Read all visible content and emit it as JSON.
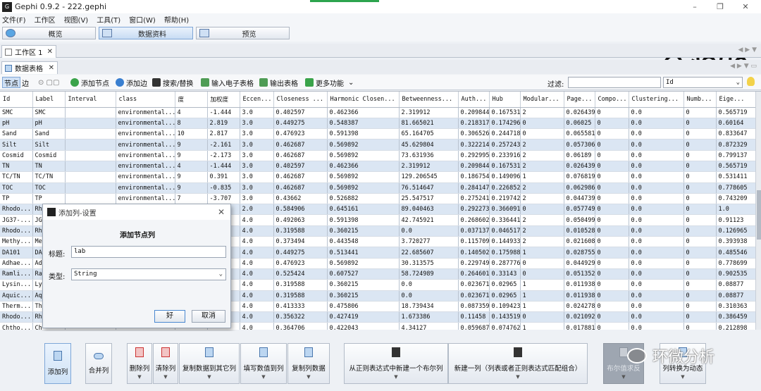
{
  "window": {
    "title": "Gephi 0.9.2 - 222.gephi",
    "app_icon": "gephi-logo-icon"
  },
  "menu": [
    "文件(F)",
    "工作区",
    "视图(V)",
    "工具(T)",
    "窗口(W)",
    "帮助(H)"
  ],
  "modes": [
    {
      "label": "概览"
    },
    {
      "label": "数据资料"
    },
    {
      "label": "预览"
    }
  ],
  "logo_text": "gephi",
  "workspace_tab": {
    "label": "工作区 1",
    "close": "✕"
  },
  "datatable_tab": {
    "label": "数据表格",
    "close": "✕"
  },
  "toolbar": {
    "nodes": "节点",
    "edges": "边",
    "add_node": "添加节点",
    "add_edge": "添加边",
    "search_replace": "搜索/替换",
    "import_sheet": "输入电子表格",
    "export_table": "输出表格",
    "more": "更多功能",
    "filter_label": "过滤:",
    "filter_value": "",
    "filter_column": "Id"
  },
  "table": {
    "columns": [
      "Id",
      "Label",
      "Interval",
      "class",
      "度",
      "加权度",
      "Eccen...",
      "Closeness ...",
      "Harmonic Closen...",
      "Betweenness...",
      "Auth...",
      "Hub",
      "Modular...",
      "Page...",
      "Compo...",
      "Clustering...",
      "Numb...",
      "Eige..."
    ],
    "rows": [
      [
        "SMC",
        "SMC",
        "",
        "environmental...",
        "4",
        "-1.444",
        "3.0",
        "0.402597",
        "0.462366",
        "2.319912",
        "0.209844",
        "0.167531",
        "2",
        "0.026439",
        "0",
        "0.0",
        "0",
        "0.565719"
      ],
      [
        "pH",
        "pH",
        "",
        "environmental...",
        "8",
        "2.819",
        "3.0",
        "0.449275",
        "0.548387",
        "81.665021",
        "0.218317",
        "0.174296",
        "0",
        "0.06025",
        "0",
        "0.0",
        "0",
        "0.60164"
      ],
      [
        "Sand",
        "Sand",
        "",
        "environmental...",
        "10",
        "2.817",
        "3.0",
        "0.476923",
        "0.591398",
        "65.164705",
        "0.306526",
        "0.244718",
        "0",
        "0.065581",
        "0",
        "0.0",
        "0",
        "0.833647"
      ],
      [
        "Silt",
        "Silt",
        "",
        "environmental...",
        "9",
        "-2.161",
        "3.0",
        "0.462687",
        "0.569892",
        "45.629804",
        "0.322214",
        "0.257243",
        "2",
        "0.057306",
        "0",
        "0.0",
        "0",
        "0.872329"
      ],
      [
        "Cosmid",
        "Cosmid",
        "",
        "environmental...",
        "9",
        "-2.173",
        "3.0",
        "0.462687",
        "0.569892",
        "73.631936",
        "0.292995",
        "0.233916",
        "2",
        "0.06189",
        "0",
        "0.0",
        "0",
        "0.799137"
      ],
      [
        "TN",
        "TN",
        "",
        "environmental...",
        "4",
        "-1.444",
        "3.0",
        "0.402597",
        "0.462366",
        "2.319912",
        "0.209844",
        "0.167531",
        "2",
        "0.026439",
        "0",
        "0.0",
        "0",
        "0.565719"
      ],
      [
        "TC/TN",
        "TC/TN",
        "",
        "environmental...",
        "9",
        "0.391",
        "3.0",
        "0.462687",
        "0.569892",
        "129.206545",
        "0.186754",
        "0.149096",
        "1",
        "0.076819",
        "0",
        "0.0",
        "0",
        "0.531411"
      ],
      [
        "TOC",
        "TOC",
        "",
        "environmental...",
        "9",
        "-0.835",
        "3.0",
        "0.462687",
        "0.569892",
        "76.514647",
        "0.284147",
        "0.226852",
        "2",
        "0.062986",
        "0",
        "0.0",
        "0",
        "0.778605"
      ],
      [
        "TP",
        "TP",
        "",
        "environmental...",
        "7",
        "-3.707",
        "3.0",
        "0.43662",
        "0.526882",
        "25.547517",
        "0.275241",
        "0.219742",
        "2",
        "0.044739",
        "0",
        "0.0",
        "0",
        "0.743209"
      ],
      [
        "Rhodo...",
        "Rh",
        "",
        "",
        "",
        "",
        "2.0",
        "0.584906",
        "0.645161",
        "89.040463",
        "0.292273",
        "0.366091",
        "0",
        "0.057749",
        "0",
        "0.0",
        "0",
        "1.0"
      ],
      [
        "JG37-...",
        "JG",
        "",
        "",
        "",
        "",
        "4.0",
        "0.492063",
        "0.591398",
        "42.745921",
        "0.268602",
        "0.336441",
        "2",
        "0.050499",
        "0",
        "0.0",
        "0",
        "0.91123"
      ],
      [
        "Rhodo...",
        "Rh",
        "",
        "",
        "",
        "",
        "4.0",
        "0.319588",
        "0.360215",
        "0.0",
        "0.037137",
        "0.046517",
        "2",
        "0.010528",
        "0",
        "0.0",
        "0",
        "0.126965"
      ],
      [
        "Methy...",
        "Me",
        "",
        "",
        "",
        "",
        "4.0",
        "0.373494",
        "0.443548",
        "3.720277",
        "0.115709",
        "0.144933",
        "2",
        "0.021608",
        "0",
        "0.0",
        "0",
        "0.393938"
      ],
      [
        "DA101",
        "DA",
        "",
        "",
        "",
        "",
        "4.0",
        "0.449275",
        "0.513441",
        "22.685607",
        "0.140502",
        "0.175988",
        "1",
        "0.028755",
        "0",
        "0.0",
        "0",
        "0.485546"
      ],
      [
        "Adhae...",
        "Ad",
        "",
        "",
        "",
        "",
        "4.0",
        "0.476923",
        "0.569892",
        "30.313575",
        "0.229749",
        "0.287776",
        "0",
        "0.044929",
        "0",
        "0.0",
        "0",
        "0.778699"
      ],
      [
        "Ramli...",
        "Ra",
        "",
        "",
        "",
        "",
        "4.0",
        "0.525424",
        "0.607527",
        "58.724989",
        "0.264601",
        "0.33143",
        "0",
        "0.051352",
        "0",
        "0.0",
        "0",
        "0.902535"
      ],
      [
        "Lysin...",
        "Ly",
        "",
        "",
        "",
        "",
        "4.0",
        "0.319588",
        "0.360215",
        "0.0",
        "0.023671",
        "0.02965",
        "1",
        "0.011938",
        "0",
        "0.0",
        "0",
        "0.08877"
      ],
      [
        "Aquic...",
        "Aq",
        "",
        "",
        "",
        "",
        "4.0",
        "0.319588",
        "0.360215",
        "0.0",
        "0.023671",
        "0.02965",
        "1",
        "0.011938",
        "0",
        "0.0",
        "0",
        "0.08877"
      ],
      [
        "Therm...",
        "Th",
        "",
        "",
        "",
        "",
        "4.0",
        "0.413333",
        "0.475806",
        "18.739434",
        "0.087359",
        "0.109423",
        "1",
        "0.024278",
        "0",
        "0.0",
        "0",
        "0.310363"
      ],
      [
        "Rhodo...",
        "Rh",
        "",
        "",
        "",
        "",
        "4.0",
        "0.356322",
        "0.427419",
        "1.673386",
        "0.11458",
        "0.143519",
        "0",
        "0.021092",
        "0",
        "0.0",
        "0",
        "0.386459"
      ],
      [
        "Chtho...",
        "Ch",
        "",
        "",
        "",
        "",
        "4.0",
        "0.364706",
        "0.422043",
        "4.34127",
        "0.059687",
        "0.074762",
        "1",
        "0.017881",
        "0",
        "0.0",
        "0",
        "0.212898"
      ]
    ]
  },
  "dialog": {
    "title": "添加列-设置",
    "heading": "添加节点列",
    "title_label": "标题:",
    "title_value": "lab",
    "type_label": "类型:",
    "type_value": "String",
    "ok": "好",
    "cancel": "取消"
  },
  "actions": [
    "添加列",
    "合并列",
    "删除列",
    "清除列",
    "复制数据到其它列",
    "填写数值到列",
    "复制列数据",
    "从正则表达式中新建一个布尔列",
    "新建一列（列表或者正则表达式匹配组合）",
    "布尔值求反",
    "列转换为动态"
  ],
  "watermark": "环微分析"
}
